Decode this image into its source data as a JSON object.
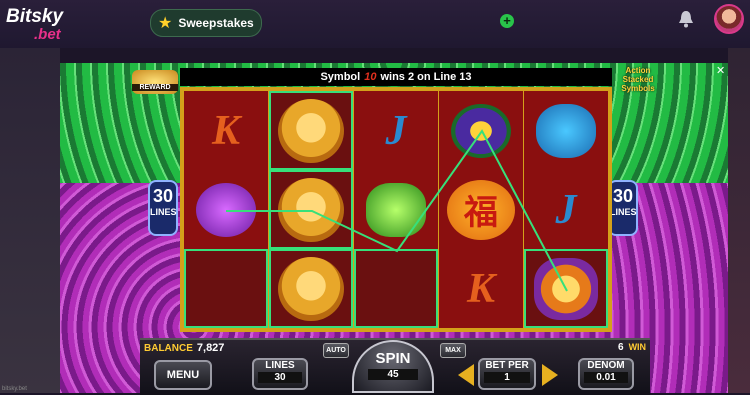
{
  "site": {
    "logo_main": "Bitsky",
    "logo_sub": ".bet",
    "sweepstakes_label": "Sweepstakes",
    "footer_url": "bitsky.bet"
  },
  "game": {
    "win_message_prefix": "Symbol",
    "win_message_symbol": "10",
    "win_message_suffix": "wins 2 on Line 13",
    "reward_label": "REWARD",
    "action_stack_label": "Action Stacked Symbols",
    "lines_badge_value": "30",
    "lines_badge_text": "LINES",
    "close_symbol": "✕"
  },
  "reels": [
    [
      "K",
      "purple-emblem",
      "empty"
    ],
    [
      "monkey",
      "monkey",
      "monkey"
    ],
    [
      "J",
      "green-bug",
      "empty"
    ],
    [
      "lotus",
      "fu-coin",
      "K"
    ],
    [
      "fish",
      "J",
      "dog"
    ]
  ],
  "win_cells": [
    [
      1,
      0
    ],
    [
      1,
      1
    ],
    [
      1,
      2
    ],
    [
      0,
      2
    ],
    [
      2,
      2
    ],
    [
      4,
      2
    ]
  ],
  "controls": {
    "balance_label": "BALANCE",
    "balance_value": "7,827",
    "win_value": "6",
    "win_label": "WIN",
    "menu_label": "MENU",
    "lines_label": "LINES",
    "lines_value": "30",
    "auto_label": "AUTO",
    "max_label": "MAX",
    "spin_label": "SPIN",
    "spin_value": "45",
    "bet_label": "BET PER",
    "bet_value": "1",
    "denom_label": "DENOM",
    "denom_value": "0.01"
  },
  "colors": {
    "accent_pink": "#e8308a",
    "win_green": "#37e07a",
    "gold": "#d4a01a"
  }
}
